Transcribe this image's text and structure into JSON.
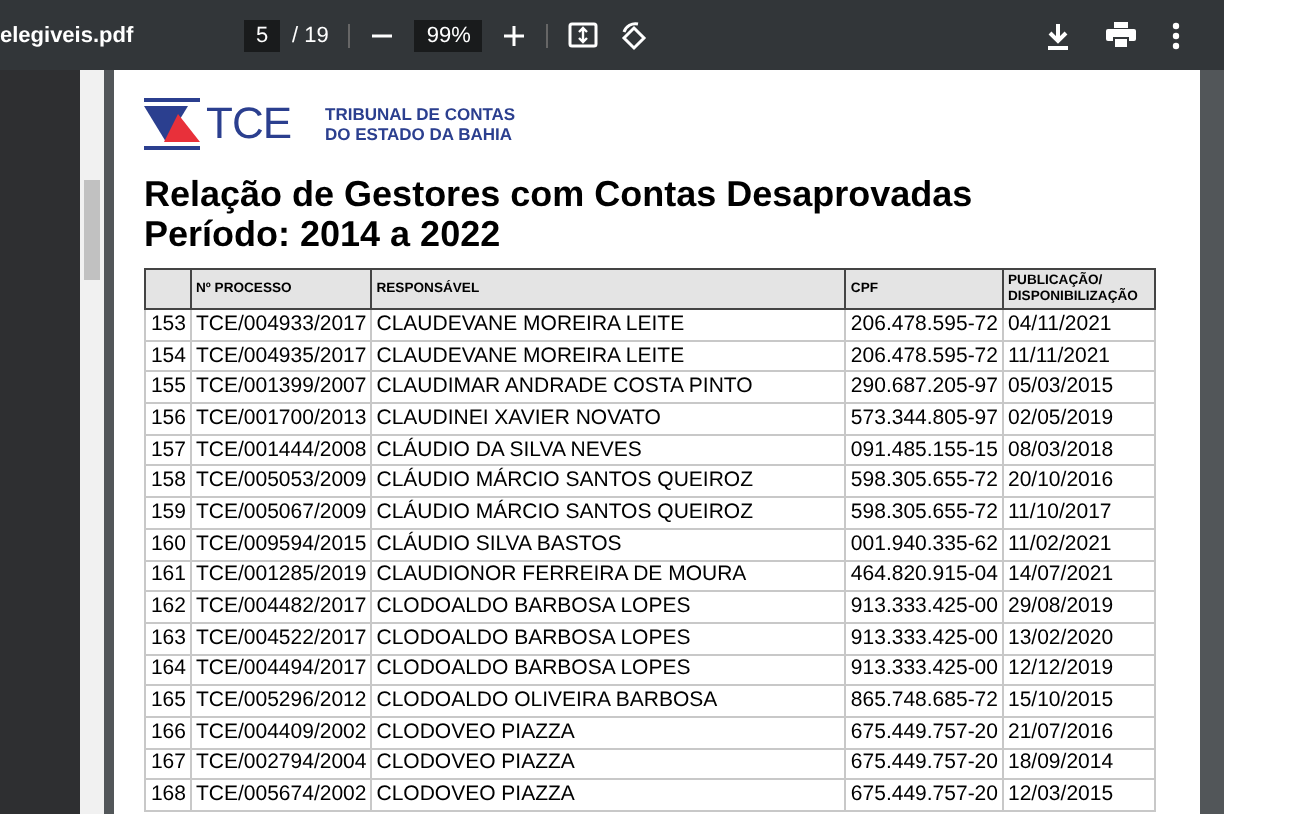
{
  "toolbar": {
    "filename": "elegiveis.pdf",
    "page": "5",
    "page_total": "/ 19",
    "zoom": "99%"
  },
  "document": {
    "logo_text": "TCE",
    "org_lines": [
      "TRIBUNAL DE CONTAS",
      "DO ESTADO DA BAHIA"
    ],
    "title_lines": [
      "Relação de Gestores com Contas Desaprovadas",
      "Período: 2014 a 2022"
    ],
    "table": {
      "columns": [
        "",
        "Nº PROCESSO",
        "RESPONSÁVEL",
        "CPF",
        "PUBLICAÇÃO/ DISPONIBILIZAÇÃO"
      ],
      "rows": [
        [
          "153",
          "TCE/004933/2017",
          "CLAUDEVANE MOREIRA LEITE",
          "206.478.595-72",
          "04/11/2021"
        ],
        [
          "154",
          "TCE/004935/2017",
          "CLAUDEVANE MOREIRA LEITE",
          "206.478.595-72",
          "11/11/2021"
        ],
        [
          "155",
          "TCE/001399/2007",
          "CLAUDIMAR ANDRADE COSTA PINTO",
          "290.687.205-97",
          "05/03/2015"
        ],
        [
          "156",
          "TCE/001700/2013",
          "CLAUDINEI XAVIER NOVATO",
          "573.344.805-97",
          "02/05/2019"
        ],
        [
          "157",
          "TCE/001444/2008",
          "CLÁUDIO DA SILVA NEVES",
          "091.485.155-15",
          "08/03/2018"
        ],
        [
          "158",
          "TCE/005053/2009",
          "CLÁUDIO MÁRCIO SANTOS QUEIROZ",
          "598.305.655-72",
          "20/10/2016"
        ],
        [
          "159",
          "TCE/005067/2009",
          "CLÁUDIO MÁRCIO SANTOS QUEIROZ",
          "598.305.655-72",
          "11/10/2017"
        ],
        [
          "160",
          "TCE/009594/2015",
          "CLÁUDIO SILVA BASTOS",
          "001.940.335-62",
          "11/02/2021"
        ],
        [
          "161",
          "TCE/001285/2019",
          "CLAUDIONOR FERREIRA DE MOURA",
          "464.820.915-04",
          "14/07/2021"
        ],
        [
          "162",
          "TCE/004482/2017",
          "CLODOALDO BARBOSA LOPES",
          "913.333.425-00",
          "29/08/2019"
        ],
        [
          "163",
          "TCE/004522/2017",
          "CLODOALDO BARBOSA LOPES",
          "913.333.425-00",
          "13/02/2020"
        ],
        [
          "164",
          "TCE/004494/2017",
          "CLODOALDO BARBOSA LOPES",
          "913.333.425-00",
          "12/12/2019"
        ],
        [
          "165",
          "TCE/005296/2012",
          "CLODOALDO OLIVEIRA BARBOSA",
          "865.748.685-72",
          "15/10/2015"
        ],
        [
          "166",
          "TCE/004409/2002",
          "CLODOVEO PIAZZA",
          "675.449.757-20",
          "21/07/2016"
        ],
        [
          "167",
          "TCE/002794/2004",
          "CLODOVEO PIAZZA",
          "675.449.757-20",
          "18/09/2014"
        ],
        [
          "168",
          "TCE/005674/2002",
          "CLODOVEO PIAZZA",
          "675.449.757-20",
          "12/03/2015"
        ]
      ]
    }
  }
}
